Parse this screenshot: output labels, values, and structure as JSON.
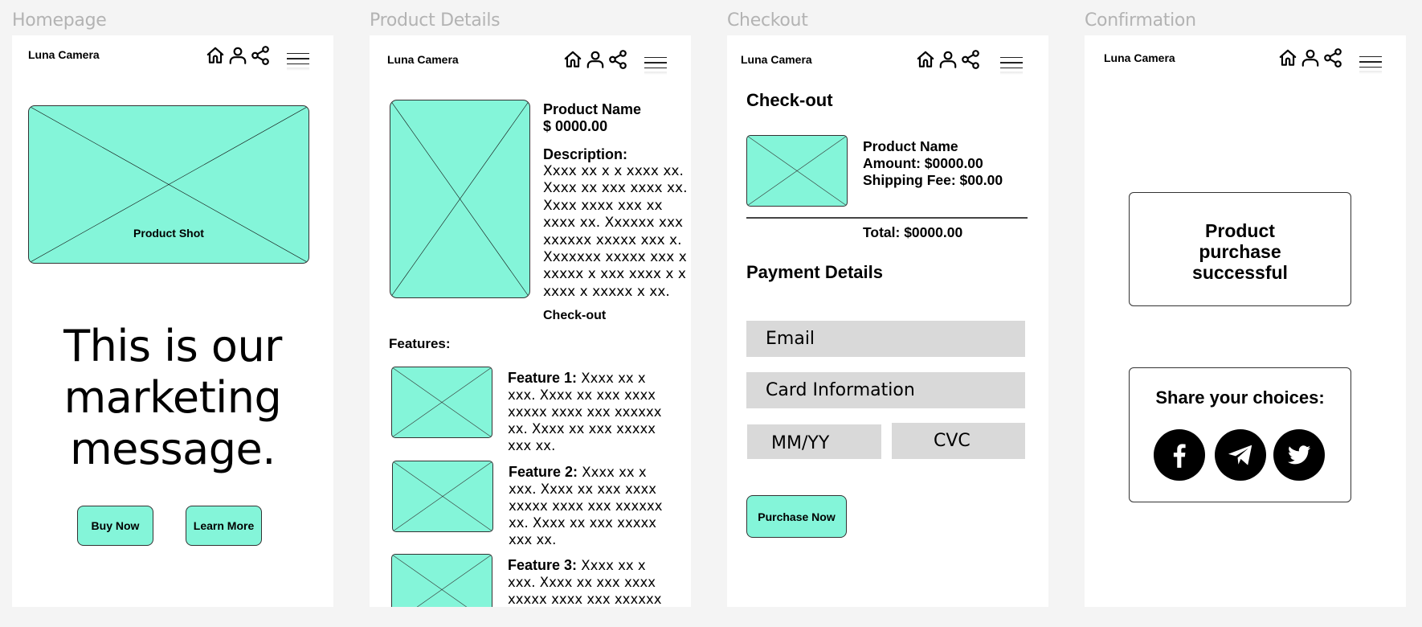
{
  "frames": {
    "homepage": "Homepage",
    "product_details": "Product Details",
    "checkout": "Checkout",
    "confirmation": "Confirmation"
  },
  "header": {
    "brand": "Luna Camera",
    "icons": [
      "home-icon",
      "user-icon",
      "share-icon",
      "hamburger-menu-icon"
    ]
  },
  "colors": {
    "accent": "#84f5d9",
    "background": "#f4f4f4",
    "field_bg": "#d9d9d9",
    "frame_label": "#b3b3b3"
  },
  "homepage": {
    "hero_label": "Product Shot",
    "marketing_line1": "This is our",
    "marketing_line2": "marketing",
    "marketing_line3": "message.",
    "buy_now": "Buy Now",
    "learn_more": "Learn More"
  },
  "product": {
    "name": "Product Name",
    "price": "$ 0000.00",
    "description_heading": "Description:",
    "description": "Xxxx xx x x  xxxx xx. Xxxx xx xxx  xxxx xx. Xxxx xxxx xxx xx xxxx xx. Xxxxxx xxx xxxxxx xxxxx xxx x. Xxxxxxx xxxxx xxx x xxxxx x xxx xxxx x x xxxx x  xxxxx x xx.",
    "checkout_link": "Check-out",
    "features_heading": "Features:",
    "features": [
      {
        "title": "Feature 1:",
        "text": " Xxxx xx x xxx. Xxxx xx xxx  xxxx xxxxx xxxx xxx xxxxxx xx. Xxxx xx xxx xxxxx xxx xx."
      },
      {
        "title": "Feature 2:",
        "text": " Xxxx xx x xxx. Xxxx xx xxx  xxxx xxxxx xxxx xxx xxxxxx xx. Xxxx xx xxx xxxxx xxx xx."
      },
      {
        "title": "Feature 3:",
        "text": " Xxxx xx x xxx. Xxxx xx xxx  xxxx xxxxx xxxx xxx xxxxxx xx. Xxxx"
      }
    ]
  },
  "checkout": {
    "title": "Check-out",
    "product_name": "Product Name",
    "amount": "Amount: $0000.00",
    "shipping": "Shipping Fee: $00.00",
    "total": "Total: $0000.00",
    "payment_heading": "Payment Details",
    "email_placeholder": "Email",
    "card_placeholder": "Card Information",
    "expiry_placeholder": "MM/YY",
    "cvc_placeholder": "CVC",
    "purchase_button": "Purchase Now"
  },
  "confirmation": {
    "success_line1": "Product",
    "success_line2": "purchase",
    "success_line3": "successful",
    "share_heading": "Share your choices:",
    "social": [
      "facebook-icon",
      "telegram-icon",
      "twitter-icon"
    ]
  }
}
